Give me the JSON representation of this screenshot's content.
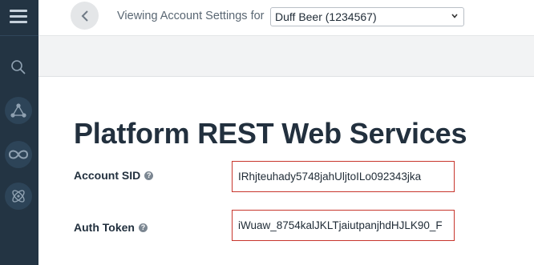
{
  "sidebar": {
    "icons": [
      "menu-icon",
      "search-icon",
      "flow-icon",
      "infinity-icon",
      "atom-icon"
    ]
  },
  "header": {
    "viewing_label": "Viewing Account Settings for",
    "account_select_value": "Duff Beer (1234567)"
  },
  "main": {
    "page_title": "Platform REST Web Services",
    "fields": [
      {
        "label": "Account SID",
        "value": "IRhjteuhady5748jahUljtoILo092343jka"
      },
      {
        "label": "Auth Token",
        "value": "iWuaw_8754kalJKLTjaiutpanjhdHJLK90_F"
      }
    ]
  },
  "colors": {
    "sidebar_bg": "#233443",
    "highlight_border": "#c8362d",
    "title_text": "#22303e"
  }
}
